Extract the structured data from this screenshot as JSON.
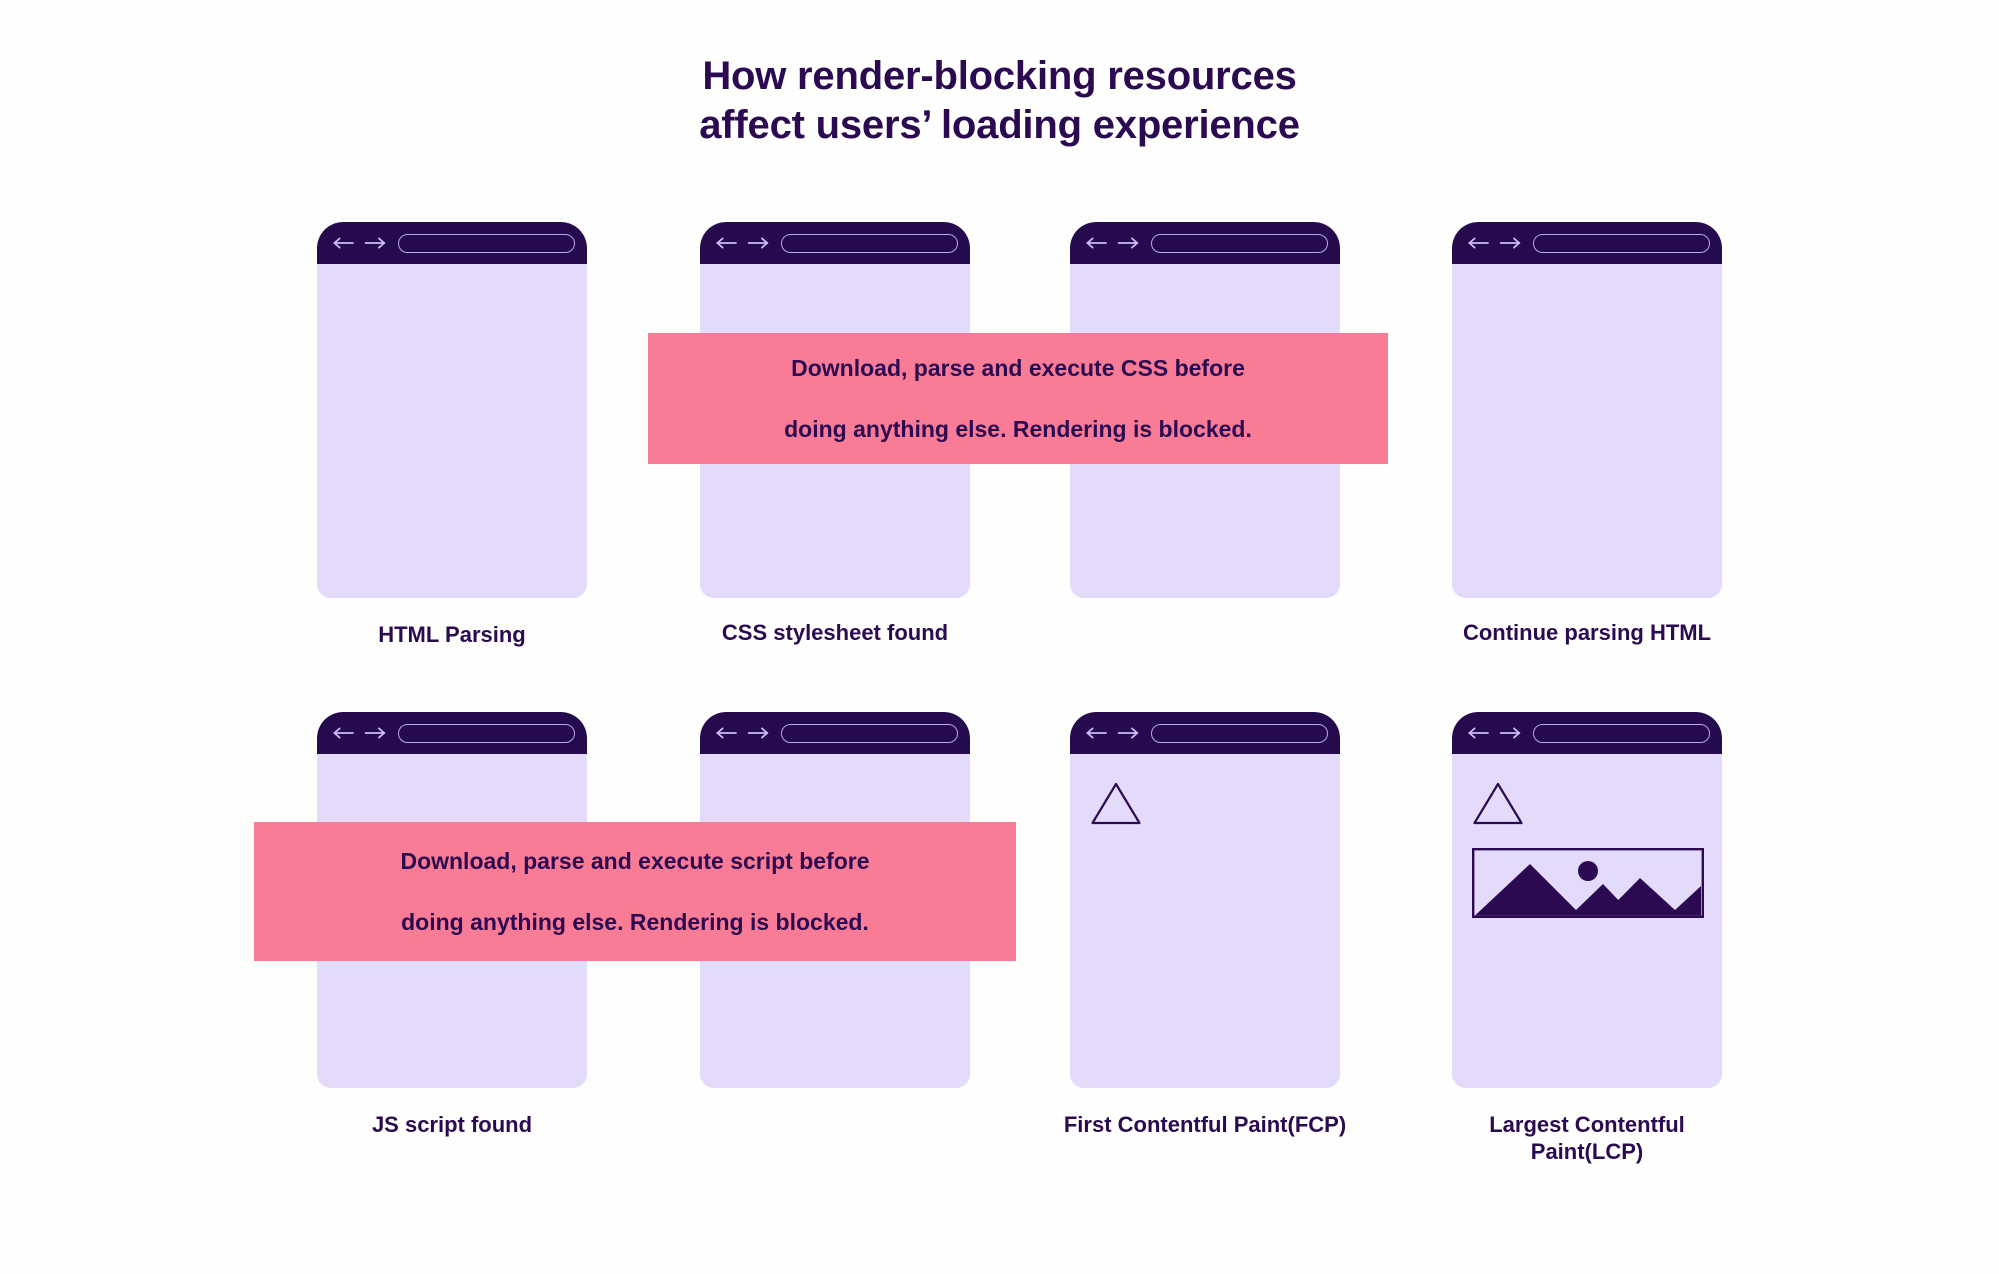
{
  "title": {
    "line1": "How render-blocking resources",
    "line2": "affect users’ loading experience"
  },
  "colors": {
    "page_background": "#fefefc",
    "ink": "#2b0a52",
    "browser_chrome": "#250b4e",
    "viewport": "#e4dbfb",
    "blocking_banner": "#f97c97",
    "urlbar_outline": "#b9a7ee"
  },
  "rows": [
    {
      "name": "row-1",
      "cards": [
        {
          "caption": "HTML Parsing",
          "icons": []
        },
        {
          "caption": "CSS stylesheet found",
          "icons": []
        },
        {
          "caption": "",
          "icons": []
        },
        {
          "caption": "Continue parsing HTML",
          "icons": []
        }
      ],
      "banner": {
        "line1": "Download, parse and execute CSS before",
        "line2": "doing anything else. Rendering is blocked."
      }
    },
    {
      "name": "row-2",
      "cards": [
        {
          "caption": "JS script found",
          "icons": []
        },
        {
          "caption": "",
          "icons": []
        },
        {
          "caption": "First Contentful Paint(FCP)",
          "icons": [
            "triangle-outline-icon"
          ]
        },
        {
          "caption": "Largest Contentful Paint(LCP)",
          "icons": [
            "triangle-outline-icon",
            "image-placeholder-icon"
          ]
        }
      ],
      "banner": {
        "line1": "Download, parse and execute script before",
        "line2": "doing anything else. Rendering is blocked."
      }
    }
  ],
  "browser_chrome_icons": {
    "back": "arrow-left-icon",
    "forward": "arrow-right-icon",
    "urlbar": "url-bar"
  }
}
